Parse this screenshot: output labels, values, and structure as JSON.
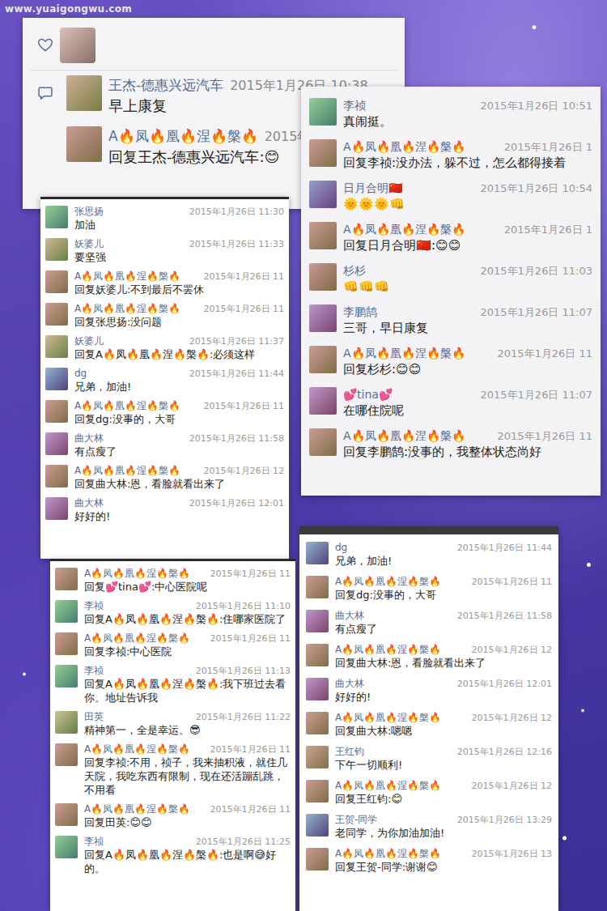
{
  "watermark": "www.yuaigongwu.com",
  "panels": [
    {
      "kind": "moment",
      "comments": [
        {
          "author": "王杰-德惠兴远汽车",
          "time": "2015年1月26日 10:38",
          "text": "早上康复"
        },
        {
          "author": "A🔥凤🔥凰🔥涅🔥槃🔥",
          "time": "2015年",
          "text": "回复王杰-德惠兴远汽车:😊"
        }
      ]
    },
    {
      "kind": "card",
      "comments": [
        {
          "author": "李祯",
          "time": "2015年1月26日 10:51",
          "text": "真闹挺。"
        },
        {
          "author": "A🔥凤🔥凰🔥涅🔥槃🔥",
          "time": "2015年1月26日 1",
          "text": "回复李祯:没办法，躲不过，怎么都得接着"
        },
        {
          "author": "日月合明🇨🇳",
          "time": "2015年1月26日 10:54",
          "text": "🌞🌞🌞👊"
        },
        {
          "author": "A🔥凤🔥凰🔥涅🔥槃🔥",
          "time": "2015年1月26日 1",
          "text": "回复日月合明🇨🇳:😊😊"
        },
        {
          "author": "杉杉",
          "time": "2015年1月26日 11:03",
          "text": "👊👊👊"
        },
        {
          "author": "李鹏鹄",
          "time": "2015年1月26日 11:07",
          "text": "三哥，早日康复"
        },
        {
          "author": "A🔥凤🔥凰🔥涅🔥槃🔥",
          "time": "2015年1月26日 11",
          "text": "回复杉杉:😊😊"
        },
        {
          "author": "💕tina💕",
          "time": "2015年1月26日 11:07",
          "text": "在哪住院呢"
        },
        {
          "author": "A🔥凤🔥凰🔥涅🔥槃🔥",
          "time": "2015年1月26日 11",
          "text": "回复李鹏鹄:没事的，我整体状态尚好"
        }
      ]
    },
    {
      "kind": "card",
      "comments": [
        {
          "author": "张思扬",
          "time": "2015年1月26日 11:30",
          "text": "加油"
        },
        {
          "author": "妖婆儿",
          "time": "2015年1月26日 11:33",
          "text": "要坚强"
        },
        {
          "author": "A🔥凤🔥凰🔥涅🔥槃🔥",
          "time": "2015年1月26日 11",
          "text": "回复妖婆儿:不到最后不罢休"
        },
        {
          "author": "A🔥凤🔥凰🔥涅🔥槃🔥",
          "time": "2015年1月26日 11",
          "text": "回复张思扬:没问题"
        },
        {
          "author": "妖婆儿",
          "time": "2015年1月26日 11:37",
          "text": "回复A🔥凤🔥凰🔥涅🔥槃🔥:必须这样"
        },
        {
          "author": "dg",
          "time": "2015年1月26日 11:44",
          "text": "兄弟，加油!"
        },
        {
          "author": "A🔥凤🔥凰🔥涅🔥槃🔥",
          "time": "2015年1月26日 11",
          "text": "回复dg:没事的，大哥"
        },
        {
          "author": "曲大林",
          "time": "2015年1月26日 11:58",
          "text": "有点瘦了"
        },
        {
          "author": "A🔥凤🔥凰🔥涅🔥槃🔥",
          "time": "2015年1月26日 12",
          "text": "回复曲大林:恩，看脸就看出来了"
        },
        {
          "author": "曲大林",
          "time": "2015年1月26日 12:01",
          "text": "好好的!"
        }
      ]
    },
    {
      "kind": "card",
      "comments": [
        {
          "author": "A🔥凤🔥凰🔥涅🔥槃🔥",
          "time": "2015年1月26日 11",
          "text": "回复💕tina💕:中心医院呢"
        },
        {
          "author": "李祯",
          "time": "2015年1月26日 11:10",
          "text": "回复A🔥凤🔥凰🔥涅🔥槃🔥:住哪家医院了"
        },
        {
          "author": "A🔥凤🔥凰🔥涅🔥槃🔥",
          "time": "2015年1月26日 11",
          "text": "回复李祯:中心医院"
        },
        {
          "author": "李祯",
          "time": "2015年1月26日 11:13",
          "text": "回复A🔥凤🔥凰🔥涅🔥槃🔥:我下班过去看你。地址告诉我"
        },
        {
          "author": "田英",
          "time": "2015年1月26日 11:22",
          "text": "精神第一，全是幸运。😎"
        },
        {
          "author": "A🔥凤🔥凰🔥涅🔥槃🔥",
          "time": "2015年1月26日 11",
          "text": "回复李祯:不用，祯子，我来抽积液，就住几天院，我吃东西有限制，现在还活蹦乱跳，不用看"
        },
        {
          "author": "A🔥凤🔥凰🔥涅🔥槃🔥",
          "time": "2015年1月26日 11",
          "text": "回复田英:😊😊"
        },
        {
          "author": "李祯",
          "time": "2015年1月26日 11:25",
          "text": "回复A🔥凤🔥凰🔥涅🔥槃🔥:也是啊😅好的。"
        }
      ]
    },
    {
      "kind": "card-bar",
      "comments": [
        {
          "author": "dg",
          "time": "2015年1月26日 11:44",
          "text": "兄弟，加油!"
        },
        {
          "author": "A🔥凤🔥凰🔥涅🔥槃🔥",
          "time": "2015年1月26日 11",
          "text": "回复dg:没事的，大哥"
        },
        {
          "author": "曲大林",
          "time": "2015年1月26日 11:58",
          "text": "有点瘦了"
        },
        {
          "author": "A🔥凤🔥凰🔥涅🔥槃🔥",
          "time": "2015年1月26日 12",
          "text": "回复曲大林:恩，看脸就看出来了"
        },
        {
          "author": "曲大林",
          "time": "2015年1月26日 12:01",
          "text": "好好的!"
        },
        {
          "author": "A🔥凤🔥凰🔥涅🔥槃🔥",
          "time": "2015年1月26日 12",
          "text": "回复曲大林:嗯嗯"
        },
        {
          "author": "王红钧",
          "time": "2015年1月26日 12:16",
          "text": "下午一切顺利!"
        },
        {
          "author": "A🔥凤🔥凰🔥涅🔥槃🔥",
          "time": "2015年1月26日 12",
          "text": "回复王红钧:😊"
        },
        {
          "author": "王贺-同学",
          "time": "2015年1月26日 13:29",
          "text": "老同学，为你加油加油!"
        },
        {
          "author": "A🔥凤🔥凰🔥涅🔥槃🔥",
          "time": "2015年1月26日 13",
          "text": "回复王贺-同学:谢谢😊"
        }
      ]
    }
  ]
}
